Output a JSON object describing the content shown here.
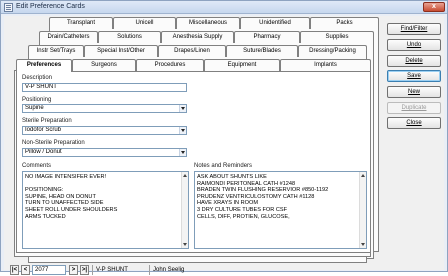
{
  "window": {
    "title": "Edit Preference Cards",
    "close_glyph": "x"
  },
  "tabs": {
    "row1": [
      "Transplant",
      "Unicell",
      "Miscellaneous",
      "Unidentified",
      "Packs"
    ],
    "row2": [
      "Drain/Catheters",
      "Solutions",
      "Anesthesia Supply",
      "Pharmacy",
      "Supplies"
    ],
    "row3": [
      "Instr Set/Trays",
      "Special Inst/Other",
      "Drapes/Linen",
      "Suture/Blades",
      "Dressing/Packing"
    ],
    "row4": [
      "Preferences",
      "Surgeons",
      "Procedures",
      "Equipment",
      "Implants"
    ],
    "active": "Preferences"
  },
  "form": {
    "description_label": "Description",
    "description_value": "V-P SHUNT",
    "positioning_label": "Positioning",
    "positioning_value": "Supine",
    "sterile_prep_label": "Sterile Preparation",
    "sterile_prep_value": "Iodofor Scrub",
    "nonsterile_prep_label": "Non-Sterile Preparation",
    "nonsterile_prep_value": "Pillow / Donut",
    "comments_label": "Comments",
    "comments_lines": [
      "NO IMAGE INTENSIFER EVER!",
      "",
      "POSITIONING:",
      "SUPINE, HEAD ON DONUT",
      "TURN TO UNAFFECTED SIDE",
      "SHEET ROLL UNDER SHOULDERS",
      "ARMS TUCKED"
    ],
    "notes_label": "Notes and Reminders",
    "notes_lines": [
      "ASK ABOUT SHUNTS LIKE",
      "RAIMONDI PERITONEAL CATH #1248",
      "BRADEN TWIN FLUSHING RESERVIOR #850-1192",
      "PRUDENZ VENTRICULOSTOMY CATH #1128",
      "HAVE XRAYS IN ROOM",
      "3 DRY CULTURE TUBES FOR CSF",
      "CELLS, DIFF, PROTIEN, GLUCOSE,"
    ]
  },
  "buttons": {
    "find": "Find/Filter",
    "undo": "Undo",
    "delete": "Delete",
    "save": "Save",
    "new": "New",
    "duplicate": "Duplicate",
    "close": "Close"
  },
  "navbar": {
    "first": "|<",
    "prev": "<",
    "record": "2077",
    "next": ">",
    "last": ">|",
    "description": "V-P SHUNT",
    "surgeon": "John Seelig"
  }
}
